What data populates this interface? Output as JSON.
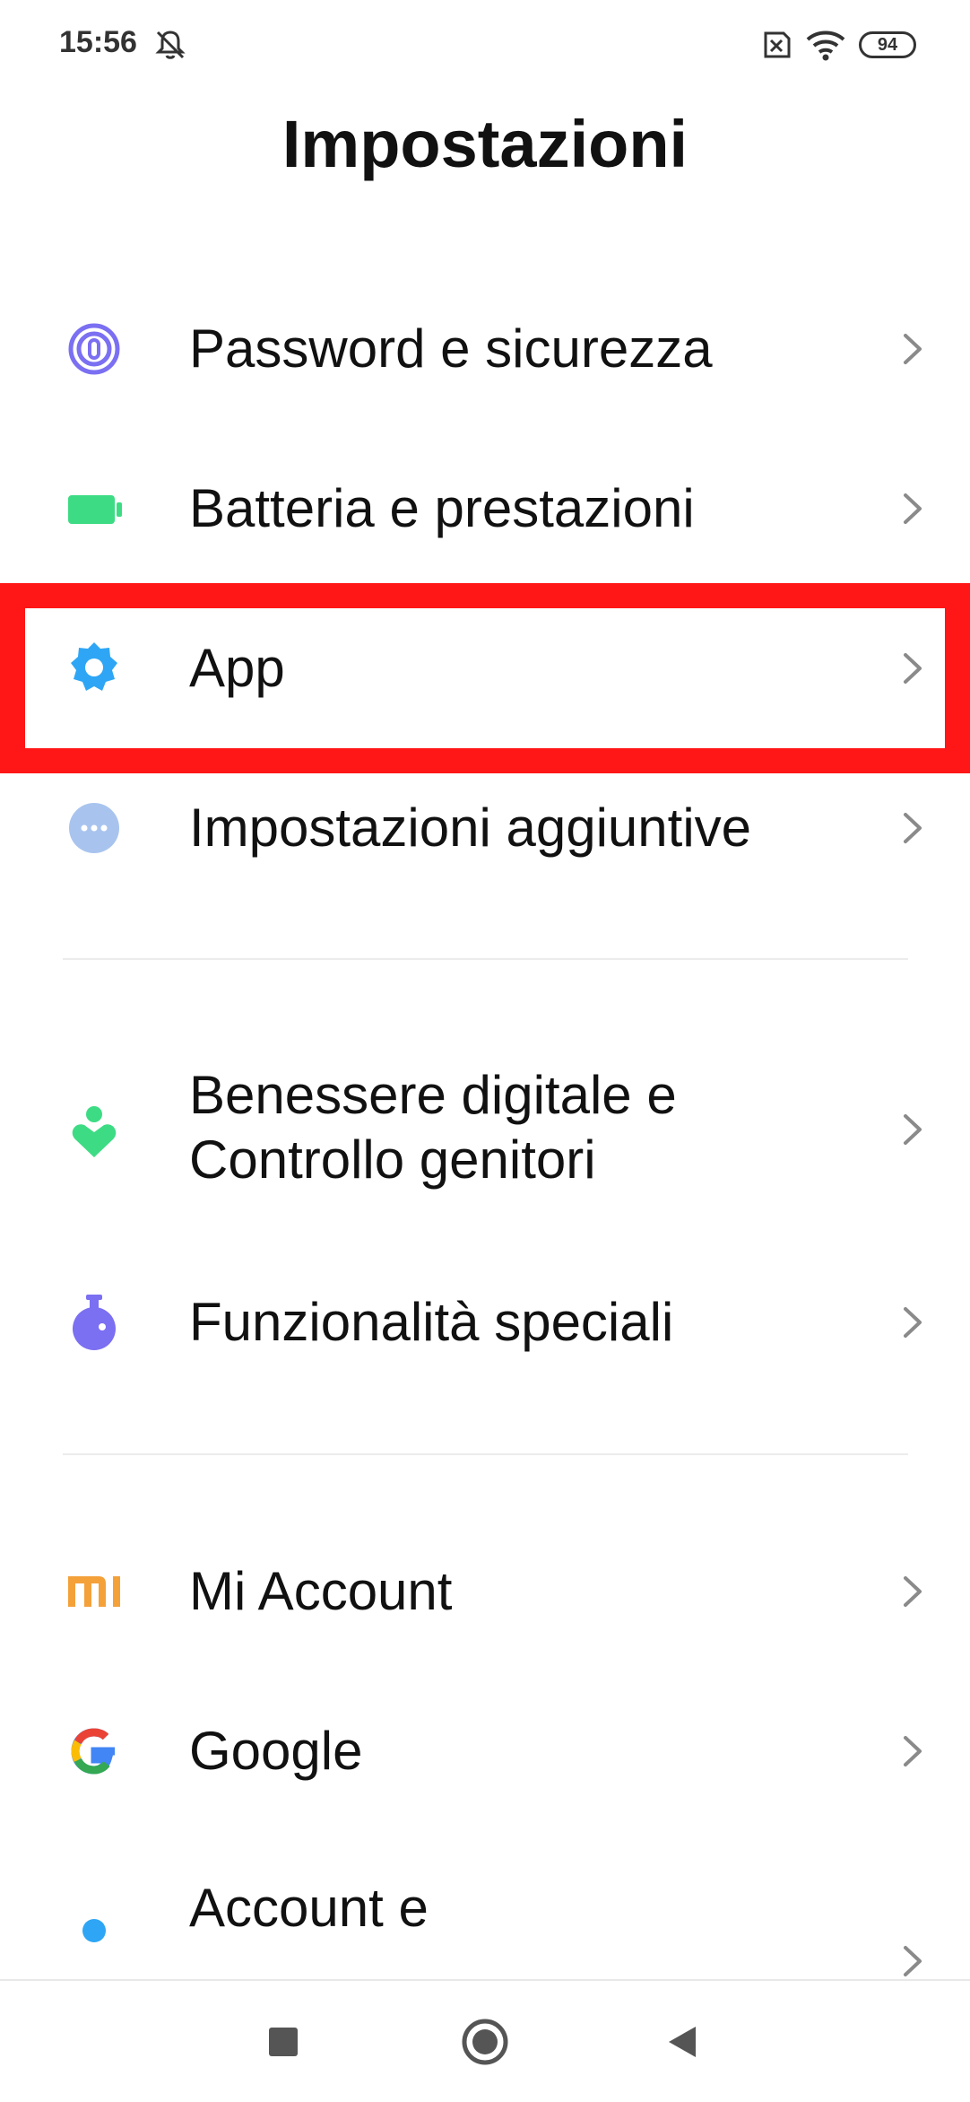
{
  "status_bar": {
    "time": "15:56",
    "battery_level": "94",
    "icons": [
      "mute-icon",
      "sim-icon",
      "wifi-icon",
      "battery-icon"
    ]
  },
  "page_title": "Impostazioni",
  "colors": {
    "highlight": "#ff1616",
    "password_icon": "#7b6ff2",
    "battery_icon": "#3ddc84",
    "app_icon": "#2ea6f5",
    "additional_icon": "#a8c4ee",
    "wellbeing_icon": "#3ddc84",
    "special_icon": "#7b6ff2",
    "mi_icon": "#f4a13a"
  },
  "items": [
    {
      "label": "Password e sicurezza",
      "icon": "fingerprint-icon"
    },
    {
      "label": "Batteria e prestazioni",
      "icon": "battery-icon"
    },
    {
      "label": "App",
      "icon": "gear-icon"
    },
    {
      "label": "Impostazioni aggiuntive",
      "icon": "more-icon"
    },
    {
      "label": "Benessere digitale e Controllo genitori",
      "icon": "wellbeing-icon"
    },
    {
      "label": "Funzionalità speciali",
      "icon": "flask-icon"
    },
    {
      "label": "Mi Account",
      "icon": "mi-logo-icon"
    },
    {
      "label": "Google",
      "icon": "google-logo-icon"
    },
    {
      "label": "Account e",
      "icon": "account-icon"
    }
  ],
  "nav_bar": [
    "recents-button",
    "home-button",
    "back-button"
  ]
}
